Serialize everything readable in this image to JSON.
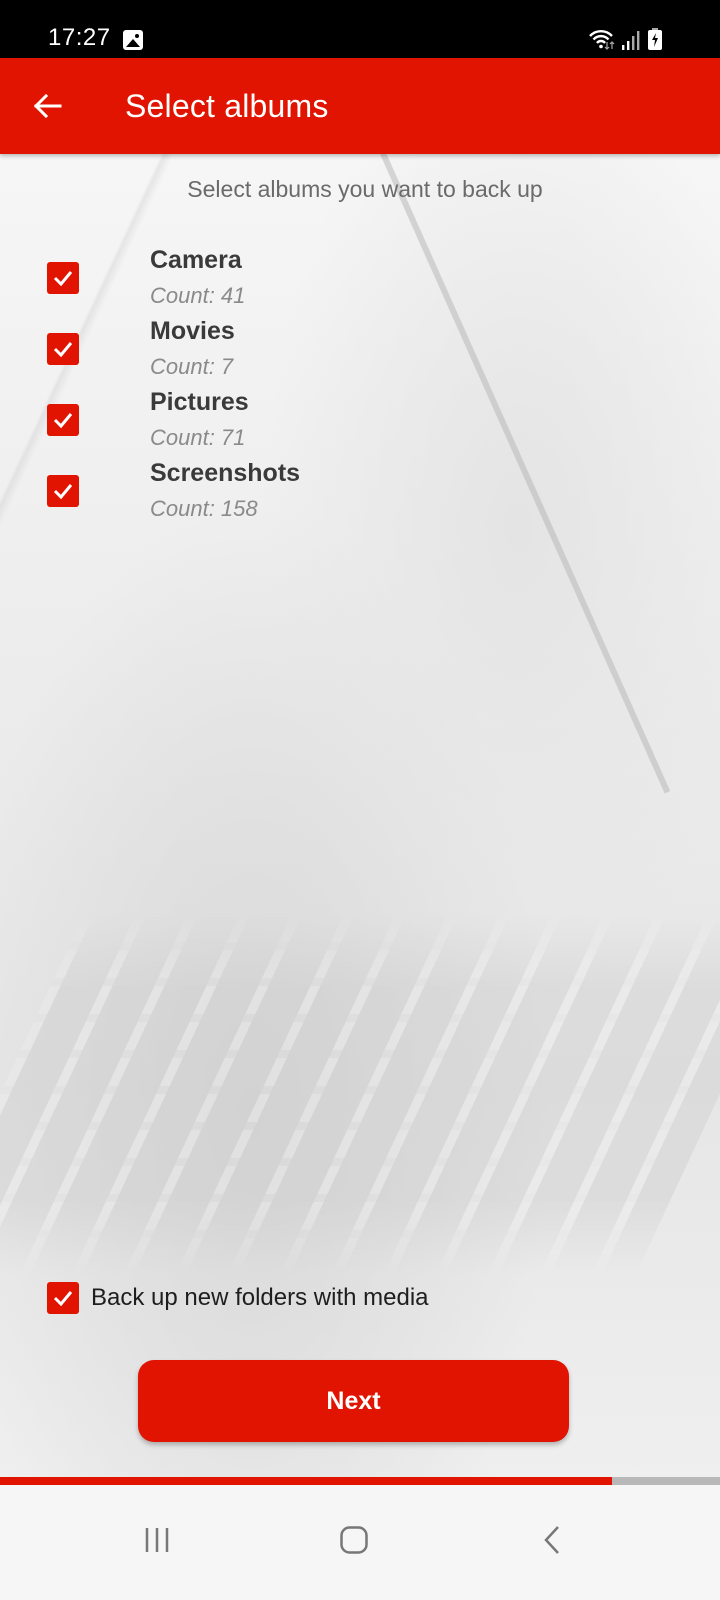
{
  "status_bar": {
    "time": "17:27",
    "icons": [
      "gallery-notification-icon",
      "wifi-icon",
      "signal-icon",
      "battery-charging-icon"
    ]
  },
  "app_bar": {
    "back_icon": "arrow-left-icon",
    "title": "Select albums"
  },
  "main": {
    "subtitle": "Select albums you want to back up",
    "albums": [
      {
        "name": "Camera",
        "count_label": "Count: 41",
        "checked": true
      },
      {
        "name": "Movies",
        "count_label": "Count: 7",
        "checked": true
      },
      {
        "name": "Pictures",
        "count_label": "Count: 71",
        "checked": true
      },
      {
        "name": "Screenshots",
        "count_label": "Count: 158",
        "checked": true
      }
    ],
    "new_folders": {
      "label": "Back up new folders with media",
      "checked": true
    },
    "next_label": "Next"
  },
  "progress": {
    "value_percent": 85
  },
  "colors": {
    "accent": "#e01400",
    "track": "#b8b8b8"
  },
  "nav_bar": {
    "buttons": [
      "recents-icon",
      "home-icon",
      "back-icon"
    ]
  }
}
